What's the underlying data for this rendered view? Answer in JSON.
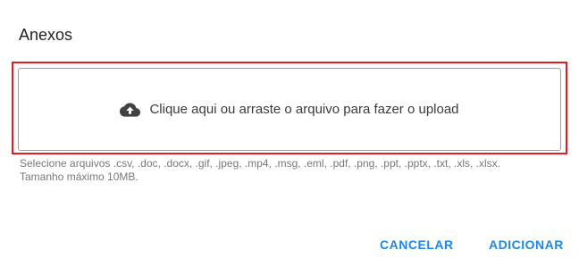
{
  "dialog": {
    "title": "Anexos"
  },
  "dropzone": {
    "icon": "cloud-upload-icon",
    "label": "Clique aqui ou arraste o arquivo para fazer o upload"
  },
  "helper": {
    "formats": "Selecione arquivos .csv, .doc, .docx, .gif, .jpeg, .mp4, .msg, .eml, .pdf, .png, .ppt, .pptx, .txt, .xls, .xlsx.",
    "max_size": "Tamanho máximo 10MB."
  },
  "actions": {
    "cancel_label": "CANCELAR",
    "add_label": "ADICIONAR"
  },
  "colors": {
    "accent": "#1e88e5",
    "highlight": "#e31b23",
    "dropzone_border": "#9e9e9e"
  }
}
